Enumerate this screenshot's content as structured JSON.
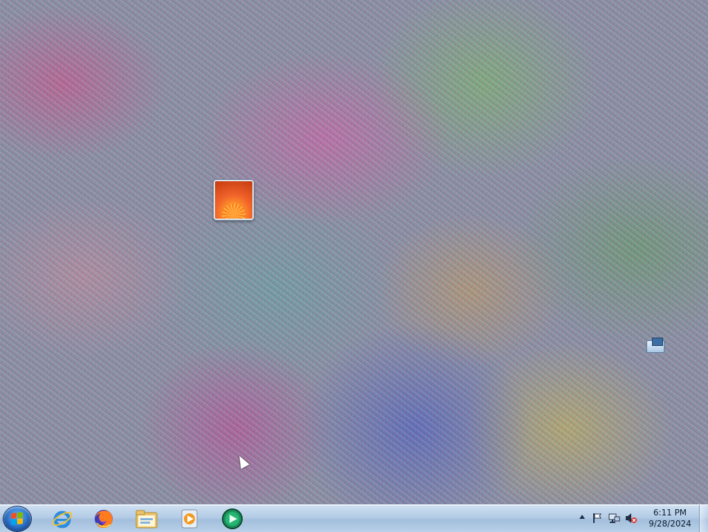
{
  "desktop": {
    "icons": [
      {
        "name": "photo-gallery-icon"
      },
      {
        "name": "network-share-icon"
      }
    ]
  },
  "taskbar": {
    "start_button": {
      "icon": "windows-logo-icon"
    },
    "pinned": [
      {
        "name": "internet-explorer-icon"
      },
      {
        "name": "firefox-icon"
      },
      {
        "name": "file-explorer-icon"
      },
      {
        "name": "windows-media-player-icon"
      },
      {
        "name": "windows-media-center-icon"
      }
    ],
    "tray": {
      "icons": [
        "show-hidden-icons-icon",
        "action-center-flag-icon",
        "network-icon",
        "volume-muted-icon"
      ],
      "time": "6:11 PM",
      "date": "9/28/2024"
    }
  }
}
